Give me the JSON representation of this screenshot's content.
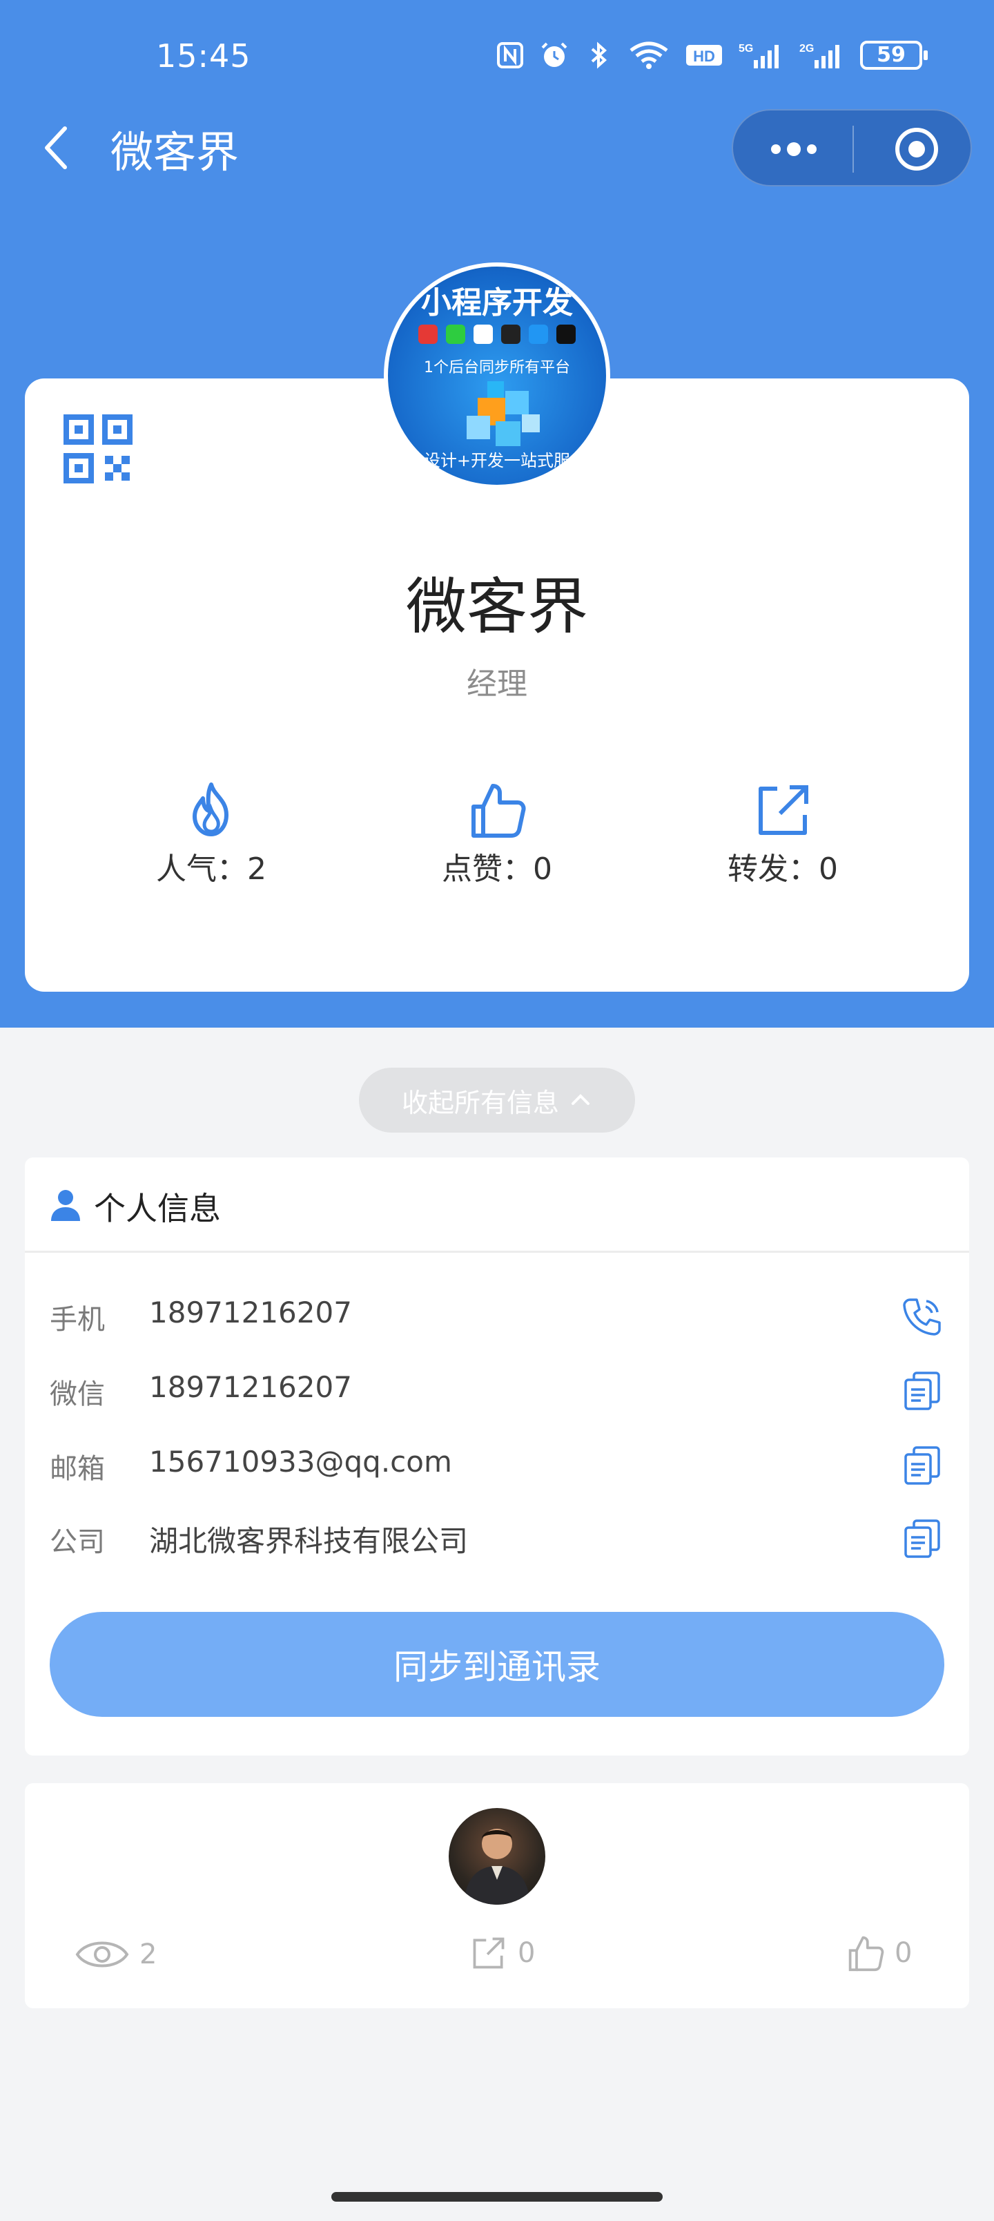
{
  "status_bar": {
    "time": "15:45",
    "battery": "59",
    "icons": [
      "nfc-icon",
      "alarm-icon",
      "bluetooth-icon",
      "wifi-icon",
      "hd-icon",
      "signal-5g-icon",
      "signal-2g-icon",
      "battery-icon"
    ]
  },
  "nav": {
    "title": "微客界",
    "back_icon": "chevron-left-icon",
    "more_icon": "more-dots-icon",
    "close_icon": "target-close-icon"
  },
  "card": {
    "avatar": {
      "title": "小程序开发",
      "subtitle": "1个后台同步所有平台",
      "footer": "设计+开发一站式服"
    },
    "name": "微客界",
    "role": "经理",
    "stats": [
      {
        "icon": "flame-icon",
        "label": "人气：2"
      },
      {
        "icon": "thumbs-up-icon",
        "label": "点赞：0"
      },
      {
        "icon": "share-icon",
        "label": "转发：0"
      }
    ]
  },
  "collapse_label": "收起所有信息",
  "personal_info": {
    "title": "个人信息",
    "rows": [
      {
        "label": "手机",
        "value": "18971216207",
        "action_icon": "phone-icon"
      },
      {
        "label": "微信",
        "value": "18971216207",
        "action_icon": "copy-icon"
      },
      {
        "label": "邮箱",
        "value": "156710933@qq.com",
        "action_icon": "copy-icon"
      },
      {
        "label": "公司",
        "value": "湖北微客界科技有限公司",
        "action_icon": "copy-icon"
      }
    ],
    "sync_button": "同步到通讯录"
  },
  "bottom_card": {
    "views": "2",
    "shares": "0",
    "likes": "0"
  },
  "colors": {
    "header_blue": "#4a8ee8",
    "accent_blue": "#3b84e6",
    "button_blue": "#74adf6"
  }
}
